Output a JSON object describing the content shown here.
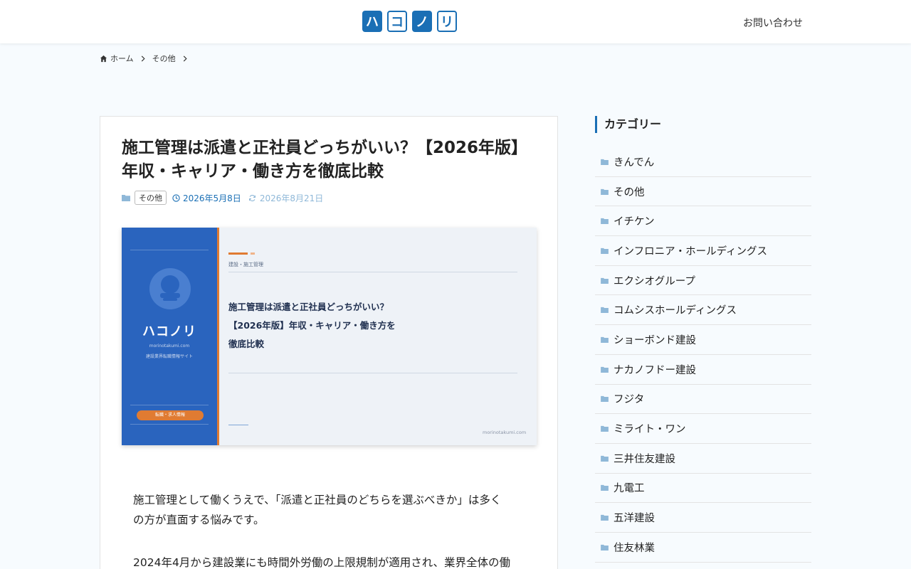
{
  "header": {
    "logo_chars": [
      "ハ",
      "コ",
      "ノ",
      "リ"
    ],
    "contact_label": "お問い合わせ"
  },
  "breadcrumb": {
    "home_label": "ホーム",
    "category_label": "その他"
  },
  "article": {
    "title_line1": "施工管理は派遣と正社員どっちがいい？【2026年版】",
    "title_line2": "年収・キャリア・働き方を徹底比較",
    "category_badge": "その他",
    "published": "2026年5月8日",
    "modified": "2026年8月21日",
    "eyecatch": {
      "brand": "ハコノリ",
      "url": "morinotakumi.com",
      "subtitle": "建設業界転職情報サイト",
      "pill": "転職・求人情報",
      "category": "建設・施工管理",
      "heading_line1": "施工管理は派遣と正社員どっちがいい？",
      "heading_line2": "【2026年版】年収・キャリア・働き方を",
      "heading_line3": "徹底比較",
      "domain": "morinotakumi.com"
    },
    "paragraph1_line1": "施工管理として働くうえで、「派遣と正社員のどちらを選ぶべきか」は多く",
    "paragraph1_line2": "の方が直面する悩みです。",
    "paragraph2_line1": "2024年4月から建設業にも時間外労働の上限規制が適用され、業界全体の働"
  },
  "sidebar": {
    "title": "カテゴリー",
    "categories": [
      "きんでん",
      "その他",
      "イチケン",
      "インフロニア・ホールディングス",
      "エクシオグループ",
      "コムシスホールディングス",
      "ショーボンド建設",
      "ナカノフドー建設",
      "フジタ",
      "ミライト・ワン",
      "三井住友建設",
      "九電工",
      "五洋建設",
      "住友林業"
    ]
  },
  "colors": {
    "brand_blue": "#1a6fb5",
    "eyecatch_blue": "#2a64be",
    "accent_orange": "#e07b32",
    "icon_light_blue": "#8fb8d8"
  }
}
